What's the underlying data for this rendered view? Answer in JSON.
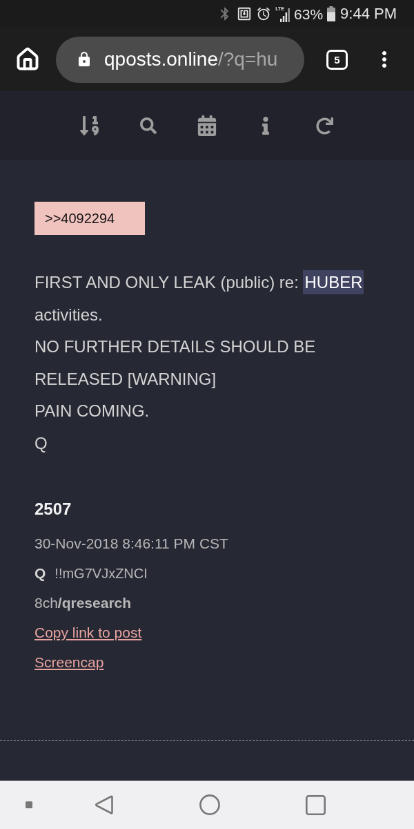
{
  "status_bar": {
    "network": "LTE",
    "battery": "63%",
    "time": "9:44 PM"
  },
  "browser": {
    "url_host": "qposts.online",
    "url_path": "/?q=hu",
    "tab_count": "5"
  },
  "post": {
    "reference": ">>4092294",
    "body": [
      {
        "segments": [
          {
            "text": "FIRST AND ONLY LEAK (public) re: ",
            "highlighted": false
          },
          {
            "text": "HUBER",
            "highlighted": true
          },
          {
            "text": " activities.",
            "highlighted": false
          }
        ]
      },
      {
        "segments": [
          {
            "text": "NO FURTHER DETAILS SHOULD BE RELEASED [WARNING]",
            "highlighted": false
          }
        ]
      },
      {
        "segments": [
          {
            "text": "PAIN COMING.",
            "highlighted": false
          }
        ]
      },
      {
        "segments": [
          {
            "text": "Q",
            "highlighted": false
          }
        ]
      }
    ],
    "number": "2507",
    "timestamp": "30-Nov-2018 8:46:11 PM CST",
    "author": "Q",
    "tripcode": "!!mG7VJxZNCI",
    "board": "8ch**/qresearch**",
    "links": [
      "Copy link to post",
      "Screencap"
    ]
  }
}
